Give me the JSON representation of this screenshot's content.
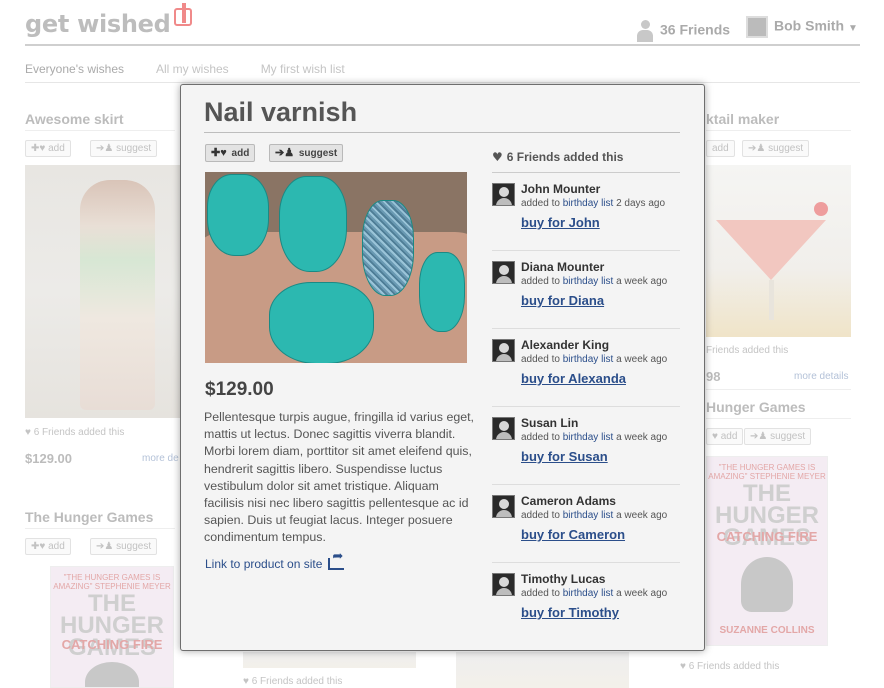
{
  "header": {
    "logo": "get wished",
    "friends_count": "36 Friends",
    "user_name": "Bob Smith"
  },
  "subnav": [
    "Everyone's wishes",
    "All my wishes",
    "My first wish list"
  ],
  "background_cards": {
    "skirt": {
      "title": "Awesome skirt",
      "add": "add",
      "suggest": "suggest",
      "friends_added": "6 Friends added this",
      "price": "$129.00",
      "more": "more de"
    },
    "cocktail": {
      "title": "ktail maker",
      "add": "add",
      "suggest": "suggest",
      "friends_added": "Friends added this",
      "price": "98",
      "more": "more details"
    },
    "hunger_left": {
      "title": "The Hunger Games",
      "add": "add",
      "suggest": "suggest",
      "book_top": "\"THE HUNGER GAMES IS AMAZING\" STEPHENIE MEYER",
      "book_title": "THE HUNGER GAMES",
      "book_sub": "CATCHING FIRE"
    },
    "hunger_right": {
      "title": "Hunger Games",
      "add": "add",
      "suggest": "suggest",
      "book_top": "\"THE HUNGER GAMES IS AMAZING\" STEPHENIE MEYER",
      "book_title": "THE HUNGER GAMES",
      "book_sub": "CATCHING FIRE",
      "book_author": "SUZANNE COLLINS",
      "friends_added": "6 Friends added this"
    },
    "bottom_mid": {
      "friends_added": "6 Friends added this"
    }
  },
  "modal": {
    "title": "Nail varnish",
    "add_label": "add",
    "suggest_label": "suggest",
    "price": "$129.00",
    "description": "Pellentesque turpis augue, fringilla id varius eget, mattis ut lectus. Donec sagittis viverra blandit. Morbi lorem diam, porttitor sit amet eleifend quis, hendrerit sagittis libero. Suspendisse luctus vestibulum dolor sit amet tristique. Aliquam facilisis nisi nec libero sagittis pellentesque ac id sapien. Duis ut feugiat lacus. Integer posuere condimentum tempus.",
    "link_label": "Link to product on site",
    "friends_header": "6 Friends added this",
    "friends": [
      {
        "name": "John Mounter",
        "pre": "added to",
        "list": "birthday list",
        "when": "2 days ago",
        "buy": "buy for John"
      },
      {
        "name": "Diana Mounter",
        "pre": "added to",
        "list": "birthday list",
        "when": "a week ago",
        "buy": "buy for Diana"
      },
      {
        "name": "Alexander King",
        "pre": "added to",
        "list": "birthday list",
        "when": "a week ago",
        "buy": "buy for Alexanda"
      },
      {
        "name": "Susan Lin",
        "pre": "added to",
        "list": "birthday list",
        "when": "a week ago",
        "buy": "buy for Susan"
      },
      {
        "name": "Cameron Adams",
        "pre": "added to",
        "list": "birthday list",
        "when": "a week ago",
        "buy": "buy for Cameron"
      },
      {
        "name": "Timothy Lucas",
        "pre": "added to",
        "list": "birthday list",
        "when": "a week ago",
        "buy": "buy for Timothy"
      }
    ]
  },
  "icons": {
    "heart": "heart-icon",
    "add": "heart-plus-icon",
    "suggest": "person-arrow-icon",
    "share": "share-icon"
  },
  "colors": {
    "link": "#2b4e8a",
    "logo_accent": "#f08a8a",
    "nail": "#2cb8b0"
  }
}
